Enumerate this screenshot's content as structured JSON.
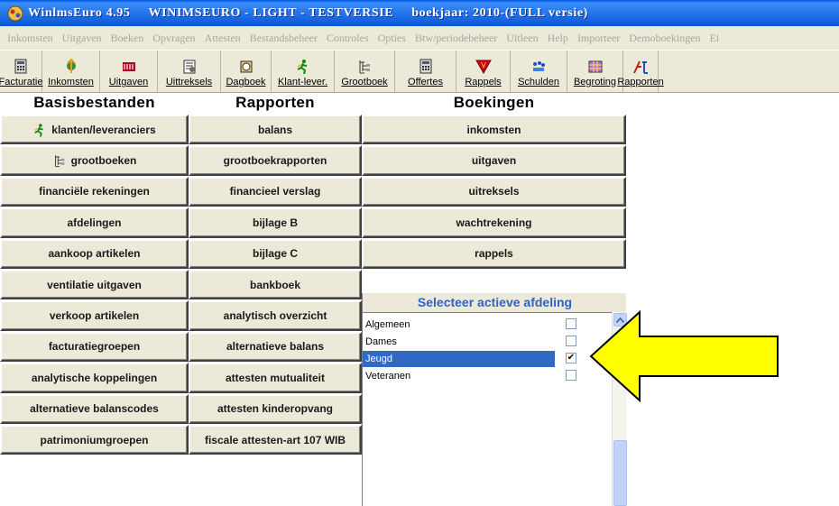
{
  "window": {
    "app_title": "WinlmsEuro 4.95",
    "edition": "WINIMSEURO - LIGHT - TESTVERSIE",
    "year": "boekjaar: 2010-(FULL versie)"
  },
  "menu": [
    "Inkomsten",
    "Uitgaven",
    "Boeken",
    "Opvragen",
    "Attesten",
    "Bestandsbeheer",
    "Controles",
    "Opties",
    "Btw/periodebeheer",
    "Uitleen",
    "Help",
    "Importeer",
    "Demoboekingen",
    "Ei"
  ],
  "toolbar": [
    {
      "label": "Facturatie",
      "icon": "calculator-icon"
    },
    {
      "label": "Inkomsten",
      "icon": "income-icon"
    },
    {
      "label": "Uitgaven",
      "icon": "expenses-icon"
    },
    {
      "label": "Uittreksels",
      "icon": "statements-icon"
    },
    {
      "label": "Dagboek",
      "icon": "journal-icon"
    },
    {
      "label": "Klant-lever.",
      "icon": "runner-icon"
    },
    {
      "label": "Grootboek",
      "icon": "ledger-icon"
    },
    {
      "label": "Offertes",
      "icon": "calculator-icon"
    },
    {
      "label": "Rappels",
      "icon": "reminder-icon"
    },
    {
      "label": "Schulden",
      "icon": "debts-icon"
    },
    {
      "label": "Begroting",
      "icon": "budget-icon"
    },
    {
      "label": "Rapporten",
      "icon": "reports-icon"
    }
  ],
  "headers": {
    "basis": "Basisbestanden",
    "rapporten": "Rapporten",
    "boekingen": "Boekingen"
  },
  "basis": [
    "klanten/leveranciers",
    "grootboeken",
    "financiële rekeningen",
    "afdelingen",
    "aankoop artikelen",
    "ventilatie uitgaven",
    "verkoop artikelen",
    "facturatiegroepen",
    "analytische koppelingen",
    "alternatieve balanscodes",
    "patrimoniumgroepen"
  ],
  "rapporten": [
    "balans",
    "grootboekrapporten",
    "financieel verslag",
    "bijlage B",
    "bijlage C",
    "bankboek",
    "analytisch overzicht",
    "alternatieve balans",
    "attesten mutualiteit",
    "attesten kinderopvang",
    "fiscale attesten-art 107 WIB"
  ],
  "boekingen": [
    "inkomsten",
    "uitgaven",
    "uitreksels",
    "wachtrekening",
    "rappels"
  ],
  "afdeling_panel": {
    "title": "Selecteer actieve afdeling",
    "items": [
      {
        "name": "Algemeen",
        "checked": false,
        "selected": false
      },
      {
        "name": "Dames",
        "checked": false,
        "selected": false
      },
      {
        "name": "Jeugd",
        "checked": true,
        "selected": true
      },
      {
        "name": "Veteranen",
        "checked": false,
        "selected": false
      }
    ]
  },
  "colors": {
    "titlebar": "#0a55d6",
    "selection": "#316ac5",
    "panel_title": "#2d62c7",
    "arrow": "#ffff00"
  }
}
